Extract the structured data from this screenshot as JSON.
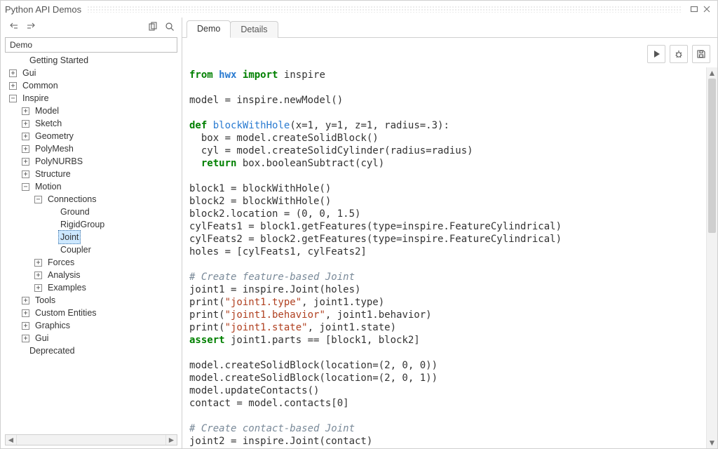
{
  "window": {
    "title": "Python API Demos"
  },
  "sidebar": {
    "header": "Demo",
    "tree": {
      "getting_started": "Getting Started",
      "gui1": "Gui",
      "common": "Common",
      "inspire": "Inspire",
      "model": "Model",
      "sketch": "Sketch",
      "geometry": "Geometry",
      "polymesh": "PolyMesh",
      "polynurbs": "PolyNURBS",
      "structure": "Structure",
      "motion": "Motion",
      "connections": "Connections",
      "ground": "Ground",
      "rigidgroup": "RigidGroup",
      "joint": "Joint",
      "coupler": "Coupler",
      "forces": "Forces",
      "analysis": "Analysis",
      "examples": "Examples",
      "tools": "Tools",
      "custom_entities": "Custom Entities",
      "graphics": "Graphics",
      "gui2": "Gui",
      "deprecated": "Deprecated"
    }
  },
  "expander": {
    "plus": "+",
    "minus": "−"
  },
  "tabs": {
    "demo": "Demo",
    "details": "Details"
  },
  "code": {
    "l1a": "from",
    "l1b": "hwx",
    "l1c": "import",
    "l1d": "inspire",
    "l3": "model = inspire.newModel()",
    "l5a": "def",
    "l5b": "blockWithHole",
    "l5c": "(x=1, y=1, z=1, radius=.3):",
    "l6": "  box = model.createSolidBlock()",
    "l7": "  cyl = model.createSolidCylinder(radius=radius)",
    "l8a": "  ",
    "l8b": "return",
    "l8c": " box.booleanSubtract(cyl)",
    "l10": "block1 = blockWithHole()",
    "l11": "block2 = blockWithHole()",
    "l12": "block2.location = (0, 0, 1.5)",
    "l13": "cylFeats1 = block1.getFeatures(type=inspire.FeatureCylindrical)",
    "l14": "cylFeats2 = block2.getFeatures(type=inspire.FeatureCylindrical)",
    "l15": "holes = [cylFeats1, cylFeats2]",
    "l17": "# Create feature-based Joint",
    "l18": "joint1 = inspire.Joint(holes)",
    "l19a": "print(",
    "l19b": "\"joint1.type\"",
    "l19c": ", joint1.type)",
    "l20a": "print(",
    "l20b": "\"joint1.behavior\"",
    "l20c": ", joint1.behavior)",
    "l21a": "print(",
    "l21b": "\"joint1.state\"",
    "l21c": ", joint1.state)",
    "l22a": "assert",
    "l22b": " joint1.parts == [block1, block2]",
    "l24": "model.createSolidBlock(location=(2, 0, 0))",
    "l25": "model.createSolidBlock(location=(2, 0, 1))",
    "l26": "model.updateContacts()",
    "l27": "contact = model.contacts[0]",
    "l29": "# Create contact-based Joint",
    "l30": "joint2 = inspire.Joint(contact)"
  }
}
